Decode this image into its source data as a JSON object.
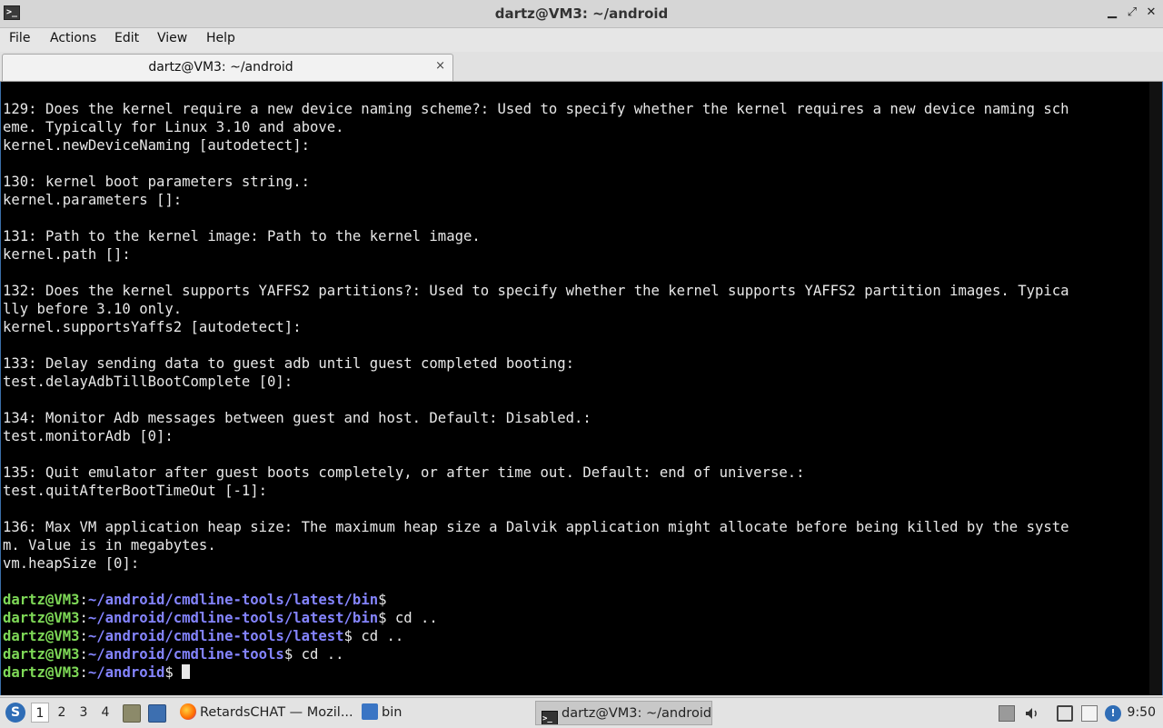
{
  "window": {
    "title": "dartz@VM3: ~/android",
    "app_icon_glyph": ">_",
    "controls": {
      "minimize": "▁",
      "restore": "⤢",
      "close": "✕"
    }
  },
  "menu": [
    "File",
    "Actions",
    "Edit",
    "View",
    "Help"
  ],
  "tab": {
    "label": "dartz@VM3: ~/android",
    "close": "×"
  },
  "terminal": {
    "lines": [
      "129: Does the kernel require a new device naming scheme?: Used to specify whether the kernel requires a new device naming sch",
      "eme. Typically for Linux 3.10 and above.",
      "kernel.newDeviceNaming [autodetect]:",
      "",
      "130: kernel boot parameters string.:",
      "kernel.parameters []:",
      "",
      "131: Path to the kernel image: Path to the kernel image.",
      "kernel.path []:",
      "",
      "132: Does the kernel supports YAFFS2 partitions?: Used to specify whether the kernel supports YAFFS2 partition images. Typica",
      "lly before 3.10 only.",
      "kernel.supportsYaffs2 [autodetect]:",
      "",
      "133: Delay sending data to guest adb until guest completed booting:",
      "test.delayAdbTillBootComplete [0]:",
      "",
      "134: Monitor Adb messages between guest and host. Default: Disabled.:",
      "test.monitorAdb [0]:",
      "",
      "135: Quit emulator after guest boots completely, or after time out. Default: end of universe.:",
      "test.quitAfterBootTimeOut [-1]:",
      "",
      "136: Max VM application heap size: The maximum heap size a Dalvik application might allocate before being killed by the syste",
      "m. Value is in megabytes.",
      "vm.heapSize [0]:",
      ""
    ],
    "prompts": [
      {
        "user": "dartz@VM3",
        "sep": ":",
        "path": "~/android/cmdline-tools/latest/bin",
        "dollar": "$",
        "cmd": ""
      },
      {
        "user": "dartz@VM3",
        "sep": ":",
        "path": "~/android/cmdline-tools/latest/bin",
        "dollar": "$",
        "cmd": " cd .."
      },
      {
        "user": "dartz@VM3",
        "sep": ":",
        "path": "~/android/cmdline-tools/latest",
        "dollar": "$",
        "cmd": " cd .."
      },
      {
        "user": "dartz@VM3",
        "sep": ":",
        "path": "~/android/cmdline-tools",
        "dollar": "$",
        "cmd": " cd .."
      },
      {
        "user": "dartz@VM3",
        "sep": ":",
        "path": "~/android",
        "dollar": "$",
        "cmd": " "
      }
    ],
    "colors": {
      "user": "#7ed957",
      "path": "#8484ff",
      "text": "#e8e8e8",
      "bg": "#000000"
    }
  },
  "taskbar": {
    "workspaces": [
      "1",
      "2",
      "3",
      "4"
    ],
    "active_workspace": "1",
    "tasks": [
      {
        "label": "RetardsCHAT — Mozil...",
        "icon": "firefox-icon"
      },
      {
        "label": "bin",
        "icon": "folder-icon"
      },
      {
        "label": "dartz@VM3: ~/android",
        "icon": "terminal-icon"
      }
    ],
    "clock": "9:50"
  }
}
